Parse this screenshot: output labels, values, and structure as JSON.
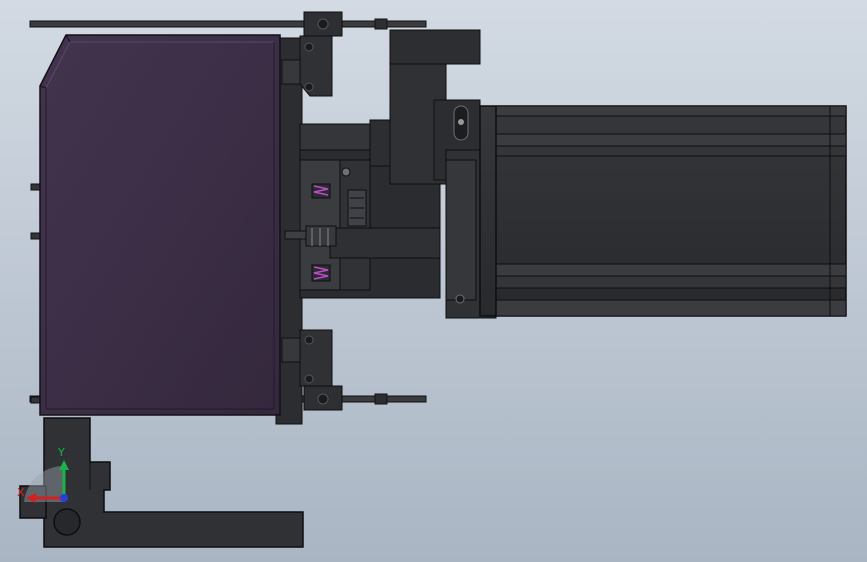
{
  "viewport": {
    "background_top": "#d3dae3",
    "background_bottom": "#a9b5c3"
  },
  "colors": {
    "body_dark": "#2e3033",
    "edge": "#0f1012",
    "housing_purple": "#3b2d45",
    "housing_purple_light": "#4a3a55",
    "spring_magenta": "#c04bc8",
    "axis_y": "#19b34a",
    "axis_x": "#d42020",
    "axis_z": "#2a3fd8"
  },
  "triad": {
    "y_label": "Y",
    "x_label": "X",
    "icon": "coordinate-triad-icon"
  }
}
